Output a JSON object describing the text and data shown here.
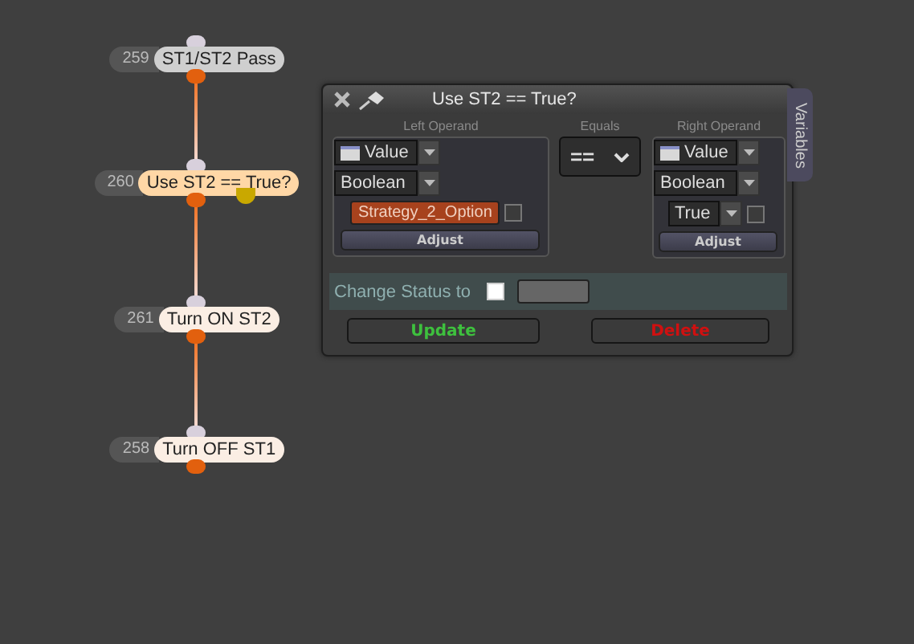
{
  "nodes": [
    {
      "number": "259",
      "label": "ST1/ST2 Pass",
      "selected": false,
      "muted": true,
      "flag": false
    },
    {
      "number": "260",
      "label": "Use ST2 == True?",
      "selected": true,
      "muted": false,
      "flag": true
    },
    {
      "number": "261",
      "label": "Turn ON ST2",
      "selected": false,
      "muted": false,
      "flag": false
    },
    {
      "number": "258",
      "label": "Turn OFF ST1",
      "selected": false,
      "muted": false,
      "flag": false
    }
  ],
  "panel": {
    "title": "Use ST2 == True?",
    "side_tab": "Variables",
    "left_operand": {
      "heading": "Left Operand",
      "source": "Value",
      "type": "Boolean",
      "field": "Strategy_2_Option",
      "checked": false,
      "button": "Adjust"
    },
    "operator": {
      "heading": "Equals",
      "value": "=="
    },
    "right_operand": {
      "heading": "Right Operand",
      "source": "Value",
      "type": "Boolean",
      "field": "True",
      "checked": false,
      "button": "Adjust"
    },
    "status": {
      "label": "Change Status to",
      "checked": false
    },
    "buttons": [
      {
        "label": "Update",
        "kind": "update"
      },
      {
        "label": "Delete",
        "kind": "delete"
      }
    ]
  }
}
